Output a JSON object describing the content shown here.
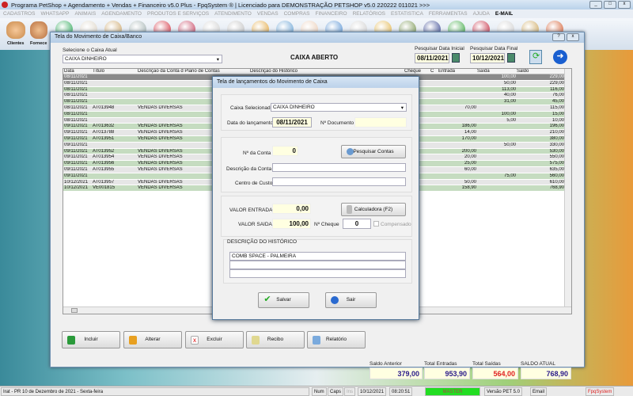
{
  "app": {
    "title": "Programa PetShop + Agendamento + Vendas + Financeiro v5.0 Plus - FpqSystem ® | Licenciado para  DEMONSTRAÇÃO PETSHOP v5.0 220222 011021 >>>"
  },
  "menu": [
    "CADASTROS",
    "WHATSAPP",
    "ANIMAIS",
    "AGENDAMENTO",
    "PRODUTOS E SERVIÇOS",
    "ATENDIMENTO",
    "VENDAS",
    "COMPRAS",
    "FINANCEIRO",
    "RELATÓRIOS",
    "ESTATISTICA",
    "FERRAMENTAS",
    "AJUDA",
    "E-MAIL"
  ],
  "toolbar": {
    "clientes": "Clientes",
    "fornece": "Fornece"
  },
  "main": {
    "title": "Tela do Movimento de Caixa/Banco",
    "caixa_label": "Selecione o Caixa Atual",
    "caixa_value": "CAIXA DINHEIRO",
    "status": "CAIXA ABERTO",
    "data_inicial_label": "Pesquisar Data Inicial",
    "data_inicial": "08/11/2021",
    "data_final_label": "Pesquisar Data Final",
    "data_final": "10/12/2021",
    "columns": [
      "Data",
      "Título",
      "Descrição da Conta d Plano de Contas",
      "Descrição do Histórico",
      "Cheque",
      "C",
      "Entrada",
      "Saída",
      "Saldo"
    ],
    "rows": [
      [
        "08/11/2021",
        "",
        "",
        "",
        "",
        "",
        "",
        "100,00",
        "229,00"
      ],
      [
        "08/11/2021",
        "",
        "",
        "",
        "",
        "",
        "",
        "50,00",
        "229,00"
      ],
      [
        "08/11/2021",
        "",
        "",
        "",
        "",
        "",
        "",
        "113,00",
        "116,00"
      ],
      [
        "08/11/2021",
        "",
        "",
        "",
        "",
        "",
        "",
        "40,00",
        "76,00"
      ],
      [
        "08/11/2021",
        "",
        "",
        "",
        "",
        "",
        "",
        "31,00",
        "45,00"
      ],
      [
        "08/11/2021",
        "AT013948",
        "VENDAS DIVERSAS",
        "",
        "",
        "",
        "70,00",
        "",
        "115,00"
      ],
      [
        "08/11/2021",
        "",
        "",
        "",
        "",
        "",
        "",
        "100,00",
        "15,00"
      ],
      [
        "08/11/2021",
        "",
        "",
        "",
        "",
        "",
        "",
        "5,00",
        "10,00"
      ],
      [
        "09/11/2021",
        "AT013632",
        "VENDAS DIVERSAS",
        "",
        "",
        "",
        "186,00",
        "",
        "196,00"
      ],
      [
        "09/11/2021",
        "AT013788",
        "VENDAS DIVERSAS",
        "",
        "",
        "",
        "14,00",
        "",
        "210,00"
      ],
      [
        "09/11/2021",
        "AT013951",
        "VENDAS DIVERSAS",
        "",
        "",
        "",
        "170,00",
        "",
        "380,00"
      ],
      [
        "09/11/2021",
        "",
        "",
        "",
        "",
        "",
        "",
        "50,00",
        "330,00"
      ],
      [
        "09/11/2021",
        "AT013952",
        "VENDAS DIVERSAS",
        "",
        "",
        "",
        "200,00",
        "",
        "530,00"
      ],
      [
        "09/11/2021",
        "AT013954",
        "VENDAS DIVERSAS",
        "",
        "",
        "",
        "20,00",
        "",
        "550,00"
      ],
      [
        "09/11/2021",
        "AT013956",
        "VENDAS DIVERSAS",
        "",
        "",
        "",
        "25,00",
        "",
        "575,00"
      ],
      [
        "09/11/2021",
        "AT013955",
        "VENDAS DIVERSAS",
        "",
        "",
        "",
        "60,00",
        "",
        "635,00"
      ],
      [
        "09/11/2021",
        "",
        "",
        "",
        "",
        "",
        "",
        "75,00",
        "560,00"
      ],
      [
        "10/12/2021",
        "AT013957",
        "VENDAS DIVERSAS",
        "",
        "",
        "",
        "50,00",
        "",
        "610,00"
      ],
      [
        "10/12/2021",
        "VE001815",
        "VENDAS DIVERSAS",
        "",
        "",
        "",
        "158,90",
        "",
        "768,90"
      ]
    ],
    "buttons": {
      "incluir": "Incluir",
      "alterar": "Alterar",
      "excluir": "Excluir",
      "recibo": "Recibo",
      "relatorio": "Relatório"
    },
    "totals": {
      "saldo_anterior_label": "Saldo Anterior",
      "saldo_anterior": "379,00",
      "entradas_label": "Total Entradas",
      "entradas": "953,90",
      "saidas_label": "Total Saídas",
      "saidas": "564,00",
      "atual_label": "SALDO ATUAL",
      "atual": "768,90"
    }
  },
  "dialog": {
    "title": "Tela de lançamentos do Movimento de Caixa",
    "caixa_label": "Caixa Selecionado",
    "caixa_value": "CAIXA DINHEIRO",
    "data_label": "Data do lançamento",
    "data_value": "08/11/2021",
    "documento_label": "Nº Documento",
    "documento_value": "",
    "conta_label": "Nº da Conta",
    "conta_value": "0",
    "pesquisar_label": "Pesquisar Contas",
    "desc_conta_label": "Descrição da Conta",
    "desc_conta_value": "",
    "centro_label": "Centro de Custo",
    "centro_value": "",
    "entrada_label": "VALOR ENTRADA",
    "entrada_value": "0,00",
    "calc_label": "Calculadora  (F2)",
    "saida_label": "VALOR SAIDA",
    "saida_value": "100,00",
    "cheque_label": "Nº Cheque",
    "cheque_value": "0",
    "compensado_label": "Compensado",
    "historico_label": "DESCRIÇÃO DO HISTÓRICO",
    "historico_lines": [
      "COMB SPACE - PALMEIRA",
      "",
      ""
    ],
    "salvar": "Salvar",
    "sair": "Sair"
  },
  "statusbar": {
    "location": "Irat - PR 10 de Dezembro de 2021 - Sexta-feira",
    "num": "Num",
    "caps": "Caps",
    "ins": "Ins",
    "date": "10/12/2021",
    "time": "08:20:51",
    "user": "MASTER",
    "version": "Versão PET 5.0",
    "email": "Email",
    "brand": "FpqSystem"
  },
  "colors": {
    "row_green": "#c5dcc0",
    "row_gray": "#e6e6e6",
    "selected": "#8a8a8a",
    "saidas": "#e02020",
    "totals": "#2a1a8a",
    "master": "#22dd22"
  }
}
